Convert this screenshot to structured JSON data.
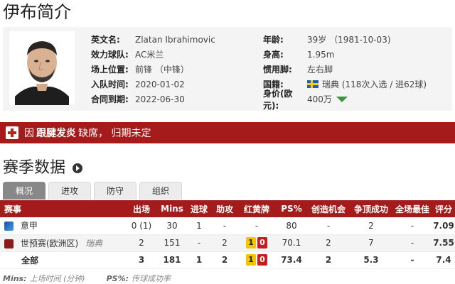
{
  "page_title": "伊布简介",
  "profile": {
    "left": [
      {
        "label": "英文名:",
        "value": "Zlatan Ibrahimovic"
      },
      {
        "label": "效力球队:",
        "value": "AC米兰"
      },
      {
        "label": "场上位置:",
        "value": "前锋 （中锋）"
      },
      {
        "label": "入队时间:",
        "value": "2020-01-02"
      },
      {
        "label": "合同到期:",
        "value": "2022-06-30"
      }
    ],
    "right": [
      {
        "label": "年龄:",
        "value": "39岁 （1981-10-03)"
      },
      {
        "label": "身高:",
        "value": "1.95m"
      },
      {
        "label": "惯用脚:",
        "value": "左右脚"
      },
      {
        "label": "国籍:",
        "value": "瑞典 (118次入选 / 进62球)"
      },
      {
        "label": "身价(欧元):",
        "value": "400万"
      }
    ],
    "flag_icon": "sweden-flag-icon",
    "value_trend_icon": "down-arrow-icon"
  },
  "injury": {
    "prefix": "因",
    "strong": "跟腱发炎",
    "suffix": "缺席， 归期未定"
  },
  "stats_title": "赛季数据",
  "tabs": [
    "概况",
    "进攻",
    "防守",
    "组织"
  ],
  "active_tab": 0,
  "table": {
    "headers": [
      "赛事",
      "出场",
      "Mins",
      "进球",
      "助攻",
      "红黄牌",
      "PS%",
      "创造机会",
      "争顶成功",
      "全场最佳",
      "评分"
    ],
    "rows": [
      {
        "comp": "意甲",
        "sub": "",
        "apps": "0 (1)",
        "mins": "30",
        "goals": "1",
        "assists": "-",
        "yellow": "",
        "red": "",
        "cards_text": "-",
        "ps": "80",
        "chances": "-",
        "aerial": "2",
        "motm": "-",
        "rating": "7.09"
      },
      {
        "comp": "世预赛(欧洲区)",
        "sub": "瑞典",
        "apps": "2",
        "mins": "151",
        "goals": "-",
        "assists": "2",
        "yellow": "1",
        "red": "0",
        "cards_text": "",
        "ps": "70.1",
        "chances": "2",
        "aerial": "7",
        "motm": "-",
        "rating": "7.55"
      },
      {
        "comp": "全部",
        "sub": "",
        "apps": "3",
        "mins": "181",
        "goals": "1",
        "assists": "2",
        "yellow": "1",
        "red": "0",
        "cards_text": "",
        "ps": "73.4",
        "chances": "2",
        "aerial": "5.3",
        "motm": "-",
        "rating": "7.4"
      }
    ]
  },
  "footnote": {
    "mins_label": "Mins:",
    "mins_text": "上场时间 (分钟)",
    "ps_label": "PS%:",
    "ps_text": "传球成功率"
  },
  "colors": {
    "brand_red": "#a51b1b",
    "rating_orange": "#e07b00",
    "yellow_card": "#f5c400",
    "red_card": "#c41e1e",
    "trend_down": "#3a9a3a"
  }
}
